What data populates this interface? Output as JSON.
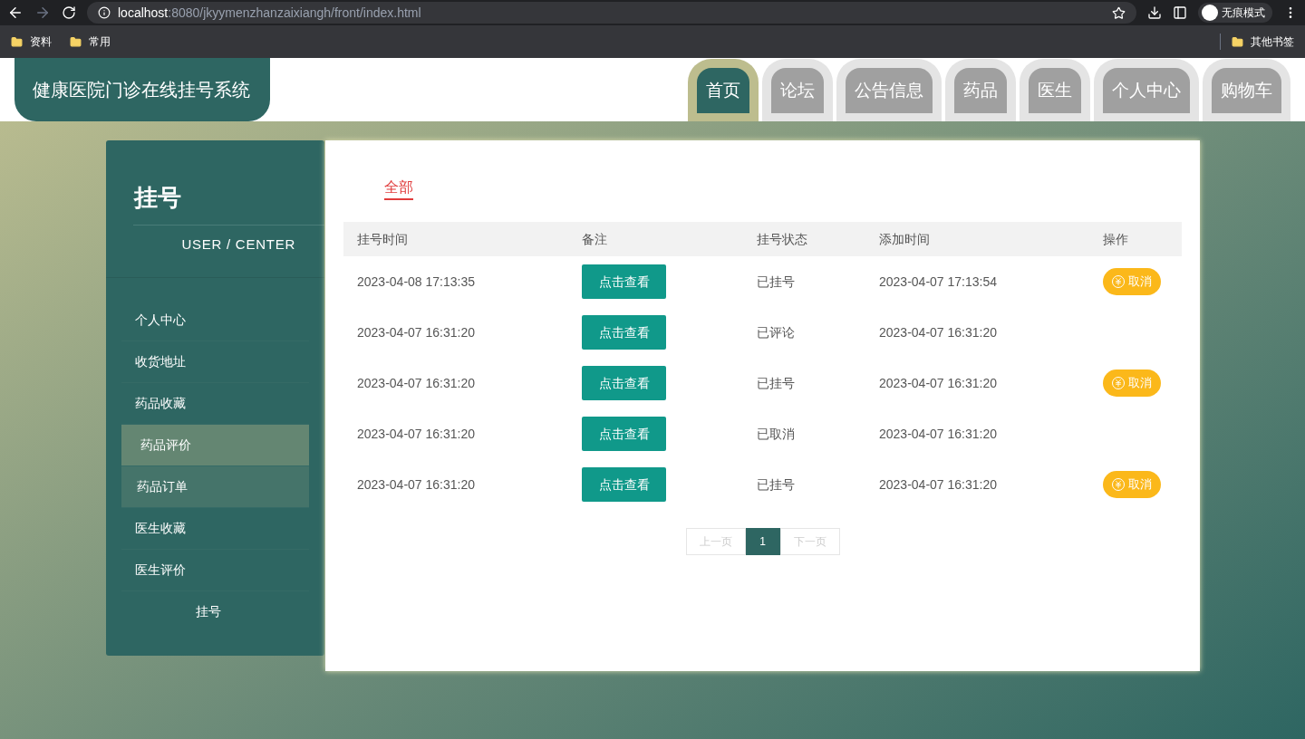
{
  "browser": {
    "url_host": "localhost",
    "url_rest": ":8080/jkyymenzhanzaixiangh/front/index.html",
    "profile": "无痕模式",
    "bookmarks": [
      "资料",
      "常用"
    ],
    "other_bookmarks": "其他书签"
  },
  "header": {
    "title": "健康医院门诊在线挂号系统",
    "nav": [
      {
        "label": "首页",
        "selected": true
      },
      {
        "label": "论坛",
        "selected": false
      },
      {
        "label": "公告信息",
        "selected": false
      },
      {
        "label": "药品",
        "selected": false
      },
      {
        "label": "医生",
        "selected": false
      },
      {
        "label": "个人中心",
        "selected": false
      },
      {
        "label": "购物车",
        "selected": false
      }
    ]
  },
  "sidebar": {
    "title": "挂号",
    "subtitle": "USER / CENTER",
    "items": [
      {
        "label": "个人中心",
        "selected": false,
        "highlighted": false,
        "kind": "link"
      },
      {
        "label": "收货地址",
        "selected": false,
        "highlighted": false,
        "kind": "link"
      },
      {
        "label": "药品收藏",
        "selected": false,
        "highlighted": false,
        "kind": "link"
      },
      {
        "label": "药品评价",
        "selected": true,
        "highlighted": false,
        "kind": "link"
      },
      {
        "label": "药品订单",
        "selected": false,
        "highlighted": true,
        "kind": "link"
      },
      {
        "label": "医生收藏",
        "selected": false,
        "highlighted": false,
        "kind": "link"
      },
      {
        "label": "医生评价",
        "selected": false,
        "highlighted": false,
        "kind": "link"
      },
      {
        "label": "挂号",
        "selected": false,
        "highlighted": false,
        "kind": "current"
      }
    ]
  },
  "filter_tabs": [
    {
      "label": "全部",
      "selected": true
    }
  ],
  "table": {
    "columns": [
      "挂号时间",
      "备注",
      "挂号状态",
      "添加时间",
      "操作"
    ],
    "rows": [
      {
        "time": "2023-04-08 17:13:35",
        "note_button": "点击查看",
        "status": "已挂号",
        "added": "2023-04-07 17:13:54",
        "action": "取消"
      },
      {
        "time": "2023-04-07 16:31:20",
        "note_button": "点击查看",
        "status": "已评论",
        "added": "2023-04-07 16:31:20"
      },
      {
        "time": "2023-04-07 16:31:20",
        "note_button": "点击查看",
        "status": "已挂号",
        "added": "2023-04-07 16:31:20",
        "action": "取消"
      },
      {
        "time": "2023-04-07 16:31:20",
        "note_button": "点击查看",
        "status": "已取消",
        "added": "2023-04-07 16:31:20"
      },
      {
        "time": "2023-04-07 16:31:20",
        "note_button": "点击查看",
        "status": "已挂号",
        "added": "2023-04-07 16:31:20",
        "action": "取消"
      }
    ]
  },
  "pagination": {
    "prev": "上一页",
    "pages": [
      {
        "label": "1",
        "selected": true
      }
    ],
    "next": "下一页"
  }
}
